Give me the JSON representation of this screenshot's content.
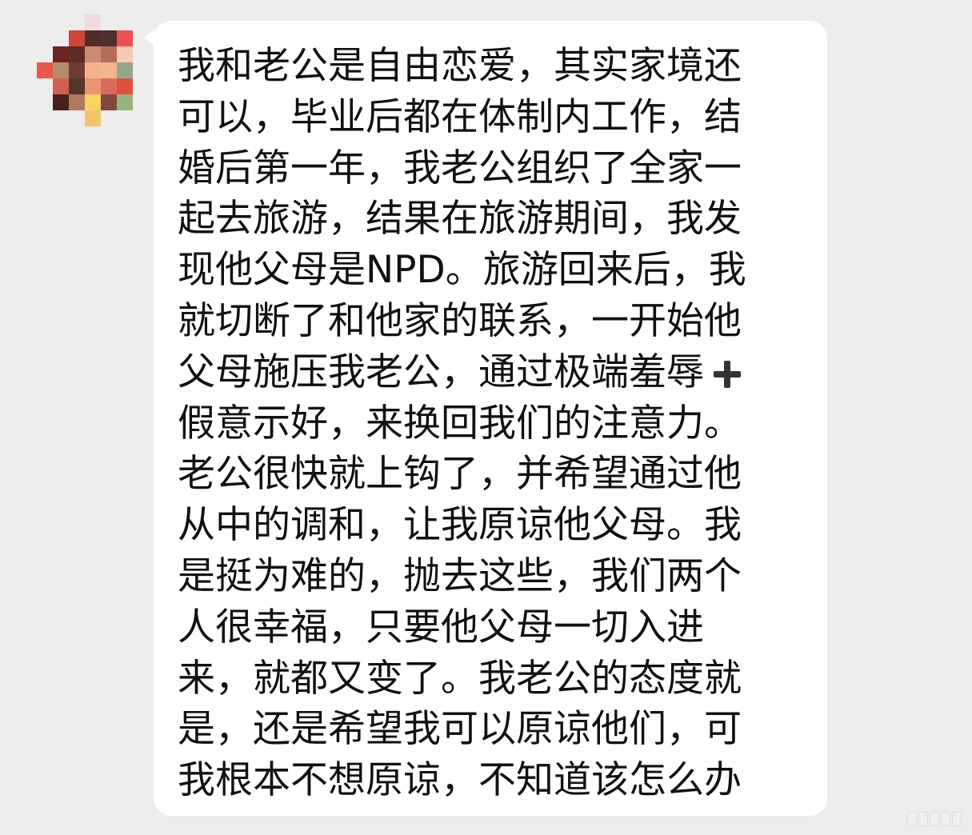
{
  "message": {
    "lines": [
      "我和老公是自由恋爱，其实家境还",
      "可以，毕业后都在体制内工作，结",
      "婚后第一年，我老公组织了全家一",
      "起去旅游，结果在旅游期间，我发",
      "现他父母是NPD。旅游回来后，我",
      "就切断了和他家的联系，一开始他",
      "父母施压我老公，通过极端羞辱",
      "假意示好，来换回我们的注意力。",
      "老公很快就上钩了，并希望通过他",
      "从中的调和，让我原谅他父母。我",
      "是挺为难的，抛去这些，我们两个",
      "人很幸福，只要他父母一切入进",
      "来，就都又变了。我老公的态度就",
      "是，还是希望我可以原谅他们，可",
      "我根本不想原谅，不知道该怎么办"
    ]
  },
  "icons": {
    "avatar": "pixelated-avatar",
    "plus": "plus-icon",
    "watermark": "watermark"
  },
  "colors": {
    "background": "#ededed",
    "bubble": "#ffffff",
    "text": "#111111",
    "plus_icon": "#333333"
  }
}
